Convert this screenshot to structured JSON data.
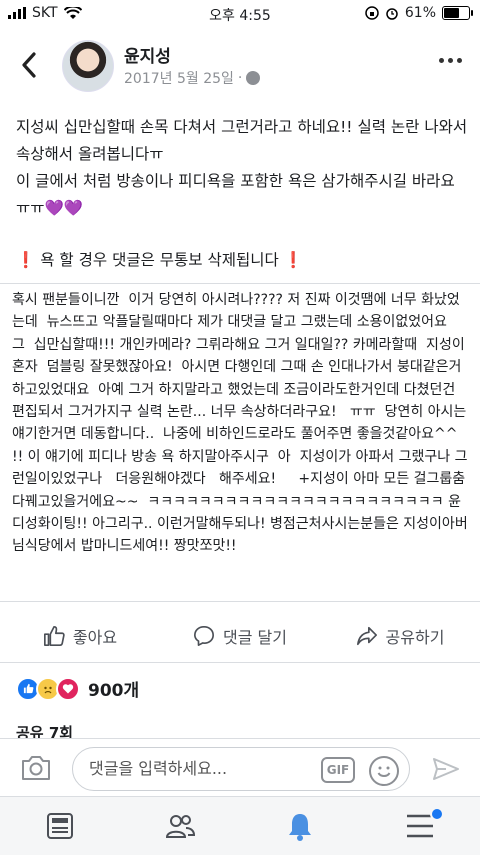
{
  "status_bar": {
    "carrier": "SKT",
    "time": "오후 4:55",
    "battery": "61%"
  },
  "post": {
    "author": "윤지성",
    "date": "2017년 5월 25일",
    "separator": "·",
    "line1": "지성씨 십만십할때 손목 다쳐서 그런거라고 하네요!! 실력 논란 나와서 속상해서 올려봅니다ㅠ",
    "line2": "이 글에서 처럼 방송이나 피디욕을 포함한 욕은 삼가해주시길 바라요ㅠㅠ",
    "hearts": "💜💜",
    "warning": "욕 할 경우 댓글은 무통보 삭제됩니다",
    "warning_mark": "❗"
  },
  "comment": {
    "text": "혹시 팬분들이니깐  이거 당연히 아시려나???? 저 진짜 이것땜에 너무 화났었는데  뉴스뜨고 악플달릴때마다 제가 대댓글 달고 그랬는데 소용이없었어요   그  십만십할때!!! 개인카메라? 그뤼라해요 그거 일대일?? 카메라할때  지성이 혼자  덤블링 잘못했잖아요!  아시면 다행인데 그때 손 인대나가서 붕대같은거하고있었대요  아예 그거 하지말라고 했었는데 조금이라도한거인데 다쳤던건 편집되서 그거가지구 실력 논란... 너무 속상하더라구요!   ㅠㅠ  당연히 아시는얘기한거면 데동합니다..  나중에 비하인드로라도 풀어주면 좋을것같아요^^  !! 이 얘기에 피디나 방송 욕 하지말아주시구  아  지성이가 아파서 그랬구나 그런일이있었구나   더응원해야겠다   해주세요!     +지성이 아마 모든 걸그룹춤 다꿰고있을거에요~~  ㅋㅋㅋㅋㅋㅋㅋㅋㅋㅋㅋㅋㅋㅋㅋㅋㅋㅋㅋㅋㅋㅋㅋ 윤디성화이팅!! 아그리구.. 이런거말해두되나! 병점근처사시는분들은 지성이아버님식당에서 밥마니드세여!! 짱맛쪼맛!!"
  },
  "actions": {
    "like": "좋아요",
    "comment": "댓글 달기",
    "share": "공유하기"
  },
  "reactions": {
    "count": "900개"
  },
  "shares": {
    "label": "공유 7회"
  },
  "composer": {
    "placeholder": "댓글을 입력하세요...",
    "gif": "GIF"
  },
  "colors": {
    "accent": "#1877f2",
    "heart_reaction": "#e0245e",
    "warning": "#e0143c"
  }
}
